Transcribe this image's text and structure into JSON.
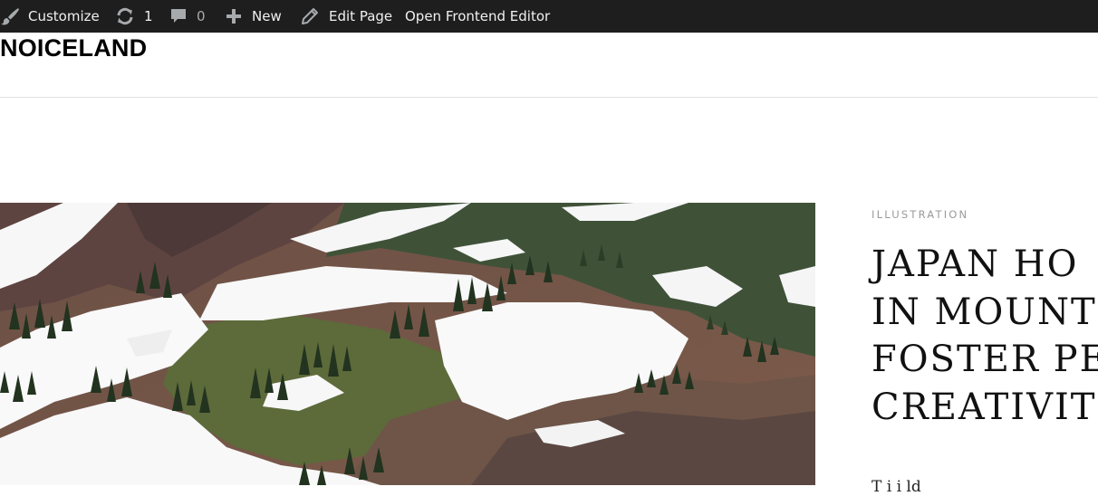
{
  "admin_bar": {
    "customize_label": "Customize",
    "updates_count": "1",
    "comments_count": "0",
    "new_label": "New",
    "edit_page_label": "Edit Page",
    "frontend_editor_label": "Open Frontend Editor",
    "icons": [
      "brush-icon",
      "update-icon",
      "comment-icon",
      "plus-icon",
      "pencil-icon"
    ]
  },
  "site": {
    "title": "NOICELAND"
  },
  "post": {
    "category": "ILLUSTRATION",
    "title_lines": [
      "JAPAN HO",
      "IN MOUNT",
      "FOSTER PE",
      "CREATIVIT"
    ],
    "excerpt": "T   i          i          ld  "
  },
  "colors": {
    "admin_bar_bg": "#1e1e1e",
    "admin_bar_text": "#f0f0f1",
    "muted_text": "#a7aaad",
    "category_text": "#9a9a9a"
  }
}
